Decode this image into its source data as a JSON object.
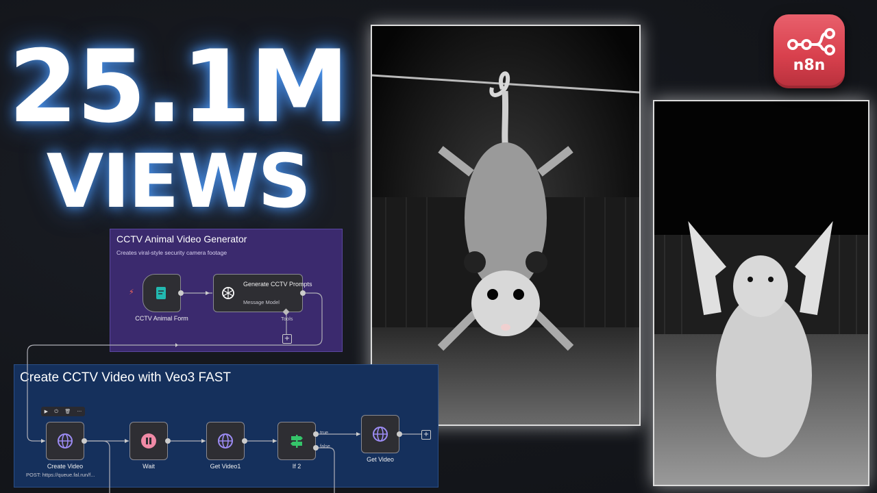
{
  "headline": {
    "line1": "25.1M",
    "line2": "VIEWS"
  },
  "workflow_top": {
    "title": "CCTV Animal Video Generator",
    "subtitle": "Creates viral-style security camera footage",
    "form_node_label": "CCTV Animal Form",
    "ai_node_title": "Generate CCTV Prompts",
    "ai_node_sub": "Message Model",
    "tools_label": "Tools",
    "plus": "+"
  },
  "workflow_bottom": {
    "title": "Create CCTV Video with Veo3 FAST",
    "nodes": {
      "create_video": "Create Video",
      "create_video_sub": "POST: https://queue.fal.run/f...",
      "wait": "Wait",
      "get_video1": "Get Video1",
      "if2": "If 2",
      "get_video": "Get Video"
    },
    "branch_true": "true",
    "branch_false": "false",
    "plus": "+",
    "toolbar_icons": [
      "play-icon",
      "power-icon",
      "trash-icon",
      "more-icon"
    ],
    "toolbar_glyphs": [
      "▶",
      "⏻",
      "🗑",
      "···"
    ]
  },
  "logo": {
    "text": "n8n"
  },
  "colors": {
    "glow": "#4aa0ff",
    "purple_panel": "#3b2a6e",
    "blue_panel": "#15305c",
    "logo": "#d9414e"
  }
}
